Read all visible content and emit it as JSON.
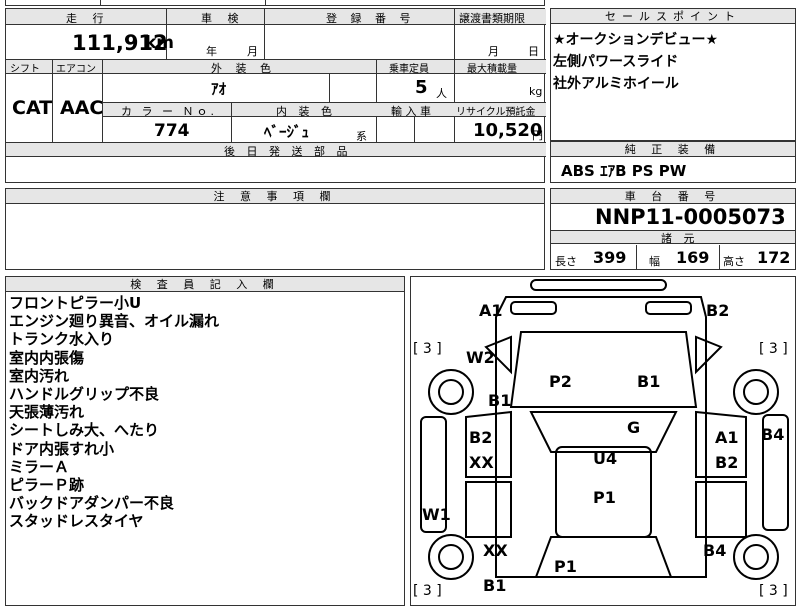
{
  "top_row": {
    "partial_text": "□□□□"
  },
  "spec": {
    "mileage_label": "走 行",
    "mileage_value": "111,912",
    "mileage_unit": "km",
    "inspection_label": "車 検",
    "inspection_year": "年",
    "inspection_month": "月",
    "reg_label": "登 録 番 号",
    "transfer_label": "譲渡書類期限",
    "transfer_month": "月",
    "transfer_day": "日",
    "shift_label": "シフト",
    "shift_value": "CAT",
    "ac_label": "エアコン",
    "ac_value": "AAC",
    "exterior_label": "外 装 色",
    "exterior_value": "ｱｵ",
    "capacity_label": "乗車定員",
    "capacity_value": "5",
    "capacity_unit": "人",
    "load_label": "最大積載量",
    "load_unit": "kg",
    "color_no_label": "カ ラ ー Ｎｏ.",
    "color_no_value": "774",
    "interior_label": "内 装 色",
    "interior_value": "ﾍﾞｰｼﾞｭ",
    "interior_suffix": "系",
    "import_label": "輸 入 車",
    "recycle_label": "リサイクル預託金",
    "recycle_value": "10,520",
    "recycle_unit": "円",
    "delivery_label": "後 日 発 送 部 品"
  },
  "sales_points": {
    "label": "セールスポイント",
    "lines": [
      "★オークションデビュー★",
      "左側パワースライド",
      "社外アルミホイール"
    ]
  },
  "equipment": {
    "label": "純 正 装 備",
    "value": "ABS ｴｱB PS PW"
  },
  "caution": {
    "label": "注 意 事 項 欄"
  },
  "chassis": {
    "label": "車 台 番 号",
    "value": "NNP11-0005073"
  },
  "dimensions": {
    "label": "諸 元",
    "length_label": "長さ",
    "length_value": "399",
    "width_label": "幅",
    "width_value": "169",
    "height_label": "高さ",
    "height_value": "172"
  },
  "inspector": {
    "label": "検 査 員 記 入 欄",
    "notes": [
      "フロントピラー小U",
      "エンジン廻り異音、オイル漏れ",
      "トランク水入り",
      "室内内張傷",
      "室内汚れ",
      "ハンドルグリップ不良",
      "天張薄汚れ",
      "シートしみ大、へたり",
      "ドア内張すれ小",
      "ミラーＡ",
      "ピラーＰ跡",
      "バックドアダンパー不良",
      "スタッドレスタイヤ"
    ]
  },
  "diagram": {
    "tire_marks": [
      "[ 3 ]",
      "[ 3 ]",
      "[ 3 ]",
      "[ 3 ]"
    ],
    "damage": {
      "front_left": "A1",
      "front_right": "B2",
      "w2": "W2",
      "p2": "P2",
      "b1_hood": "B1",
      "b1_left": "B1",
      "g": "G",
      "b2_left": "B2",
      "xx_left": "XX",
      "u4": "U4",
      "a1_right": "A1",
      "b2_right": "B2",
      "b4_right": "B4",
      "p1_roof": "P1",
      "w1": "W1",
      "xx_rear": "XX",
      "b4_rear": "B4",
      "p1_rear": "P1",
      "b1_rear": "B1"
    }
  }
}
